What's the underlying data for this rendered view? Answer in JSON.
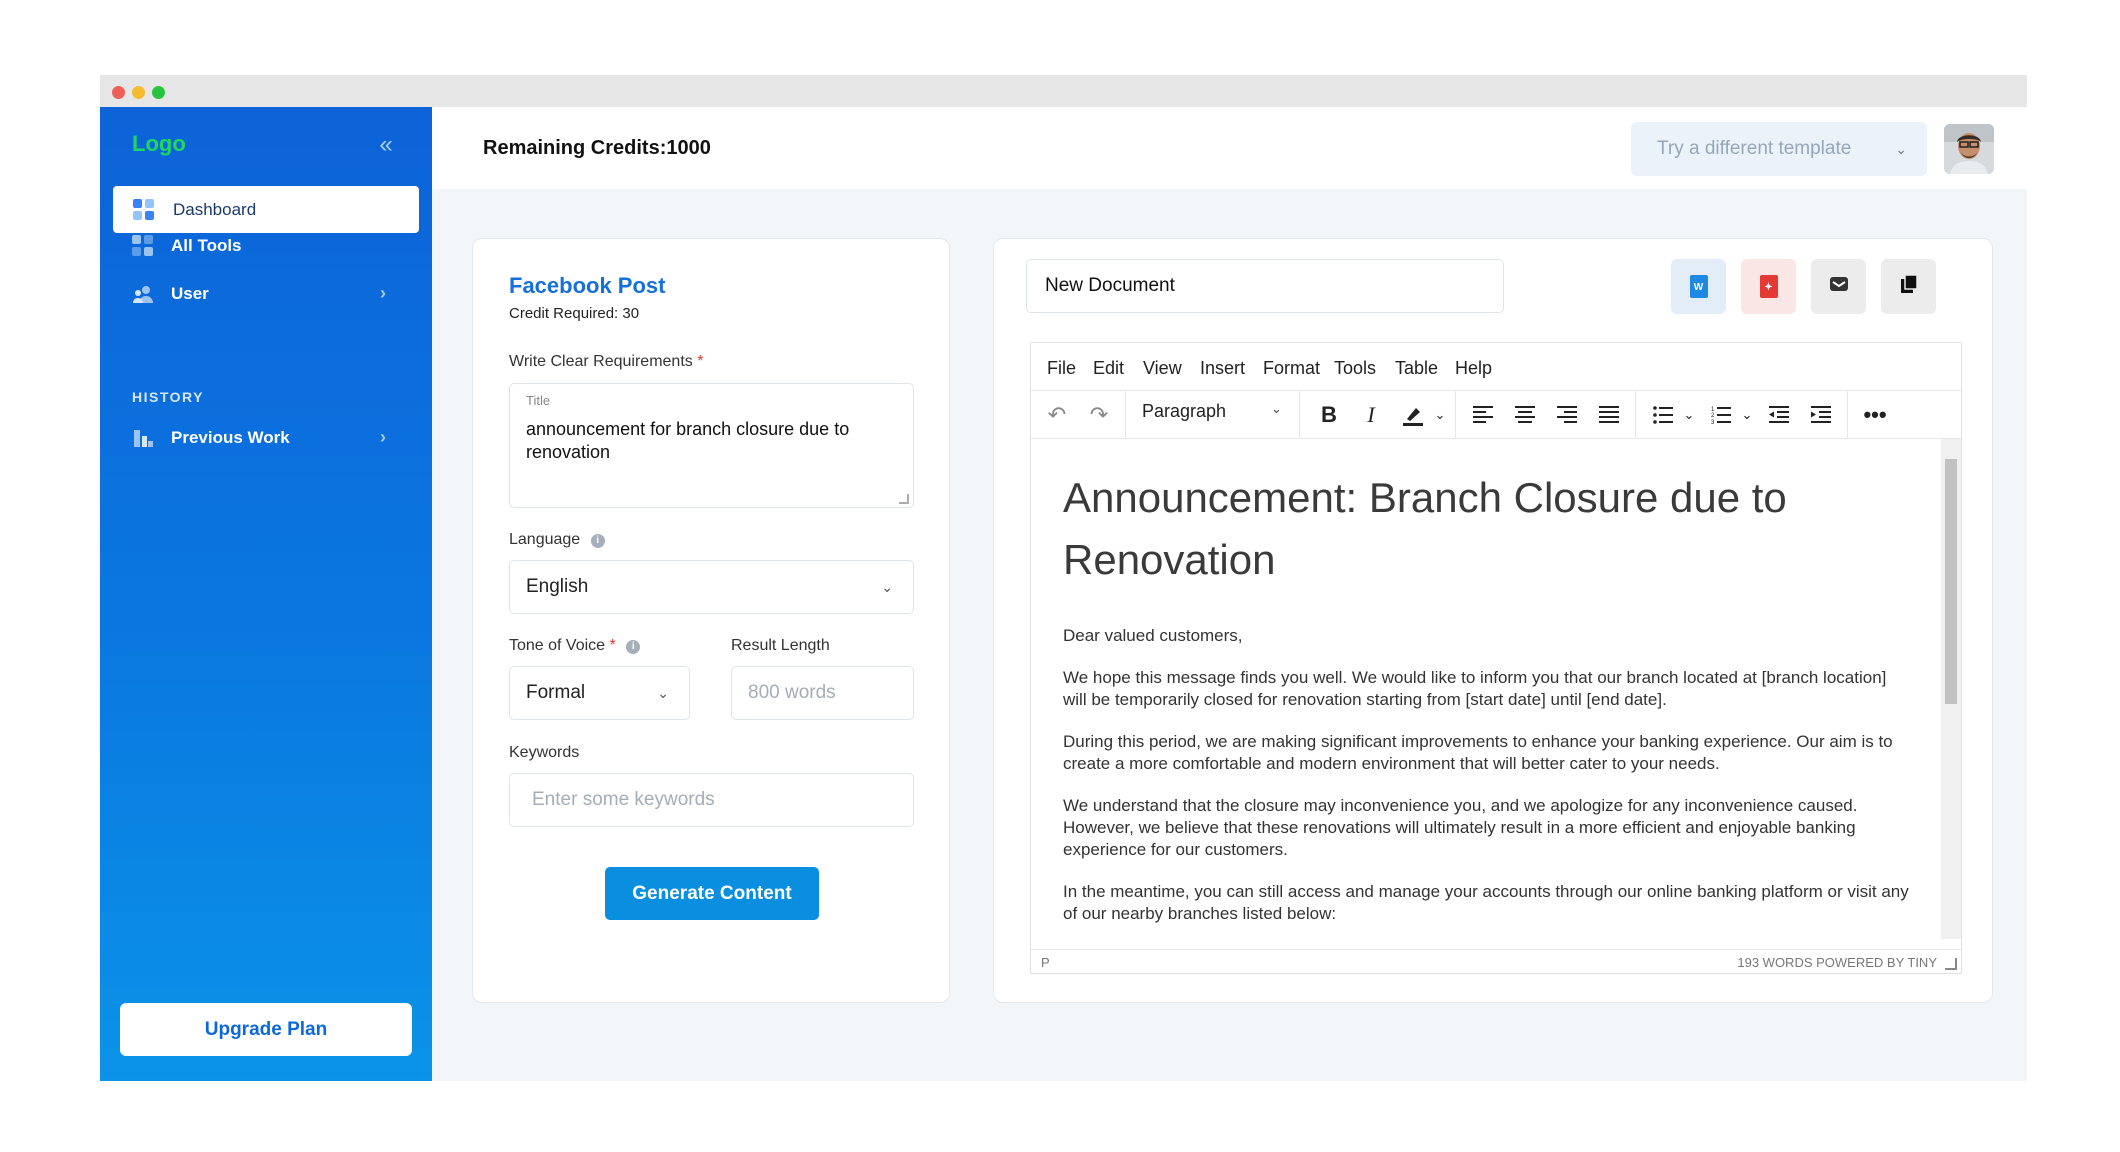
{
  "sidebar": {
    "logo": "Logo",
    "collapse_icon": "chevrons-left-icon",
    "items": [
      {
        "label": "Dashboard",
        "icon": "grid-icon",
        "active": true
      },
      {
        "label": "All Tools",
        "icon": "grid-icon",
        "active": false
      },
      {
        "label": "User",
        "icon": "users-icon",
        "active": false
      }
    ],
    "history_title": "HISTORY",
    "history_items": [
      {
        "label": "Previous Work",
        "icon": "chart-icon"
      }
    ],
    "upgrade_label": "Upgrade Plan",
    "gradient_colors": [
      "#0d63d8",
      "#0a93e8"
    ]
  },
  "header": {
    "credits": "Remaining Credits:1000",
    "template_select": "Try a different template"
  },
  "form": {
    "title": "Facebook Post",
    "credit_required": "Credit Required: 30",
    "requirements_label": "Write Clear Requirements",
    "textarea_caption": "Title",
    "textarea_value": "announcement for branch closure due to renovation",
    "language_label": "Language",
    "language_value": "English",
    "tone_label": "Tone of Voice",
    "tone_value": "Formal",
    "length_label": "Result Length",
    "length_placeholder": "800 words",
    "keywords_label": "Keywords",
    "keywords_placeholder": "Enter some keywords",
    "generate_label": "Generate Content",
    "accent_color": "#0a8fe0"
  },
  "editor": {
    "document_name": "New Document",
    "actions": [
      {
        "name": "word-export-icon",
        "color": "#1e88e5",
        "bg": "#e3edf8"
      },
      {
        "name": "pdf-export-icon",
        "color": "#e53935",
        "bg": "#fbe6e6"
      },
      {
        "name": "save-icon",
        "color": "#333333",
        "bg": "#ececec"
      },
      {
        "name": "copy-icon",
        "color": "#111111",
        "bg": "#ececec"
      }
    ],
    "menu": [
      "File",
      "Edit",
      "View",
      "Insert",
      "Format",
      "Tools",
      "Table",
      "Help"
    ],
    "block_format": "Paragraph",
    "heading": "Announcement: Branch Closure due to Renovation",
    "paragraphs": [
      "Dear valued customers,",
      "We hope this message finds you well. We would like to inform you that our branch located at [branch location] will be temporarily closed for renovation starting from [start date] until [end date].",
      "During this period, we are making significant improvements to enhance your banking experience. Our aim is to create a more comfortable and modern environment that will better cater to your needs.",
      "We understand that the closure may inconvenience you, and we apologize for any inconvenience caused. However, we believe that these renovations will ultimately result in a more efficient and enjoyable banking experience for our customers.",
      "In the meantime, you can still access and manage your accounts through our online banking platform or visit any of our nearby branches listed below:"
    ],
    "status_path": "P",
    "status_words": "193 WORDS  POWERED BY TINY"
  }
}
